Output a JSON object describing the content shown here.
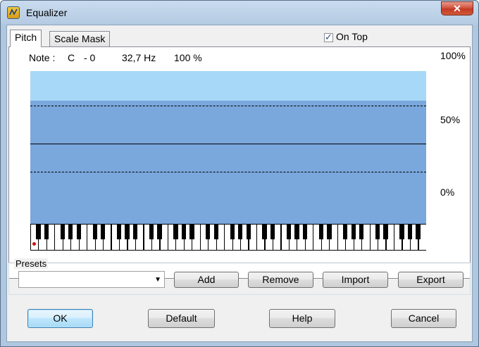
{
  "window": {
    "title": "Equalizer",
    "close_glyph": "✕"
  },
  "tabs": [
    {
      "label": "Pitch",
      "active": true
    },
    {
      "label": "Scale Mask",
      "active": false
    }
  ],
  "on_top": {
    "label": "On Top",
    "checked": true
  },
  "note": {
    "label": "Note :",
    "name": "C",
    "octave": "- 0",
    "frequency": "32,7 Hz",
    "level": "100 %"
  },
  "graph": {
    "y_labels": {
      "top": "100%",
      "mid": "50%",
      "bottom": "0%"
    },
    "colors": {
      "upper_band": "#a7d8f7",
      "lower_area": "#7aa7dc",
      "marker": "#d01010"
    }
  },
  "presets": {
    "label": "Presets",
    "selected": "",
    "buttons": {
      "add": "Add",
      "remove": "Remove",
      "import": "Import",
      "export": "Export"
    }
  },
  "footer": {
    "ok": "OK",
    "default": "Default",
    "help": "Help",
    "cancel": "Cancel"
  }
}
